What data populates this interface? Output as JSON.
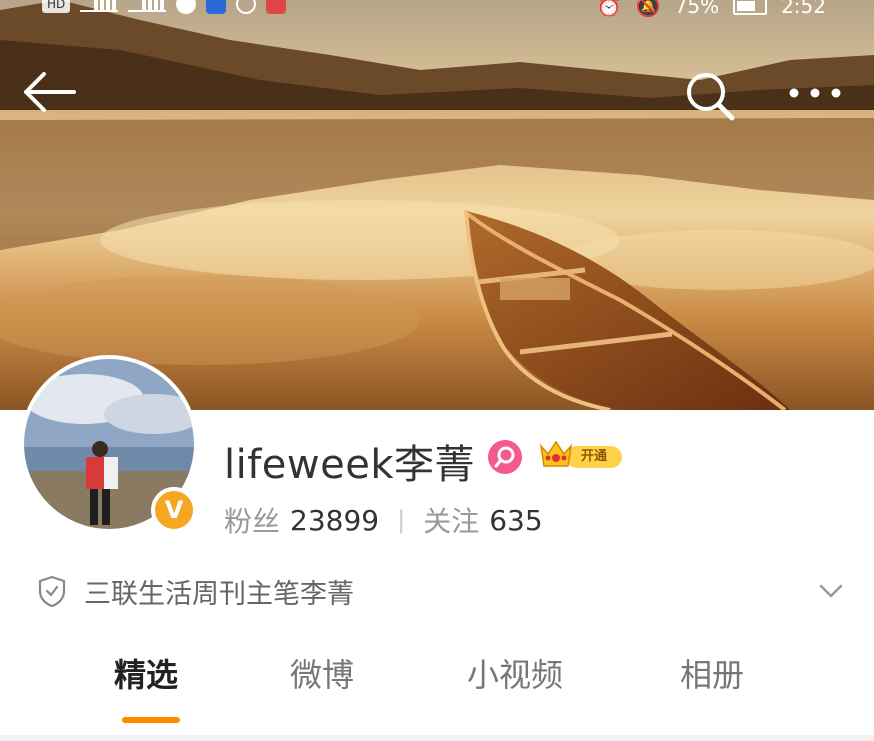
{
  "status_bar": {
    "left_badge": "HD",
    "battery": "75%",
    "time": "2:52"
  },
  "colors": {
    "accent_orange": "#ff8a00",
    "verify_badge": "#f5a623",
    "pink_badge": "#f45b8c",
    "vip_gold": "#ffd24a"
  },
  "top_nav": {
    "back_icon": "arrow-left-icon",
    "search_icon": "search-icon",
    "more_icon": "more-horizontal-icon"
  },
  "profile": {
    "username": "lifeweek李菁",
    "vip_label": "开通",
    "fans_label": "粉丝",
    "fans_count": "23899",
    "following_label": "关注",
    "following_count": "635",
    "verified_mark": "V",
    "verification_text": "三联生活周刊主笔李菁"
  },
  "tabs": [
    {
      "label": "精选",
      "active": true
    },
    {
      "label": "微博",
      "active": false
    },
    {
      "label": "小视频",
      "active": false
    },
    {
      "label": "相册",
      "active": false
    }
  ]
}
